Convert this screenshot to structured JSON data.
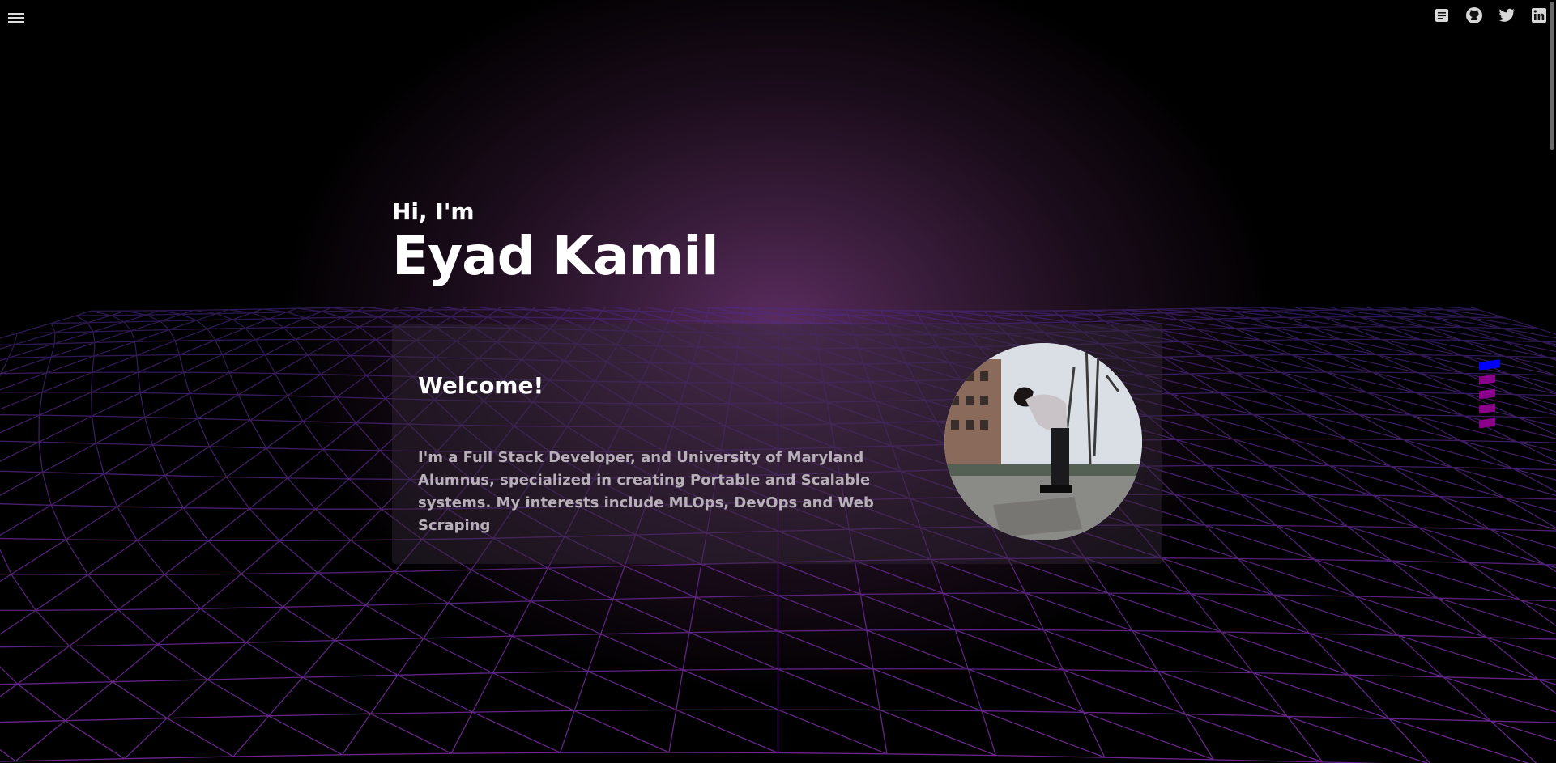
{
  "nav": {
    "menu_icon": "hamburger-menu-icon",
    "social_icons": [
      "resume-icon",
      "github-icon",
      "twitter-icon",
      "linkedin-icon"
    ]
  },
  "hero": {
    "greeting": "Hi, I'm",
    "name": "Eyad Kamil"
  },
  "card": {
    "title": "Welcome!",
    "bio": "I'm a Full Stack Developer, and University of Maryland Alumnus, specialized in creating Portable and Scalable systems. My interests include MLOps, DevOps and Web Scraping"
  },
  "section_nav": {
    "count": 5,
    "active_index": 0,
    "active_color": "#0000ff",
    "inactive_color": "#8a008a"
  },
  "colors": {
    "grid": "#7a2aa0",
    "glow": "#5a2c5e",
    "text_muted": "#b8b0b8"
  }
}
